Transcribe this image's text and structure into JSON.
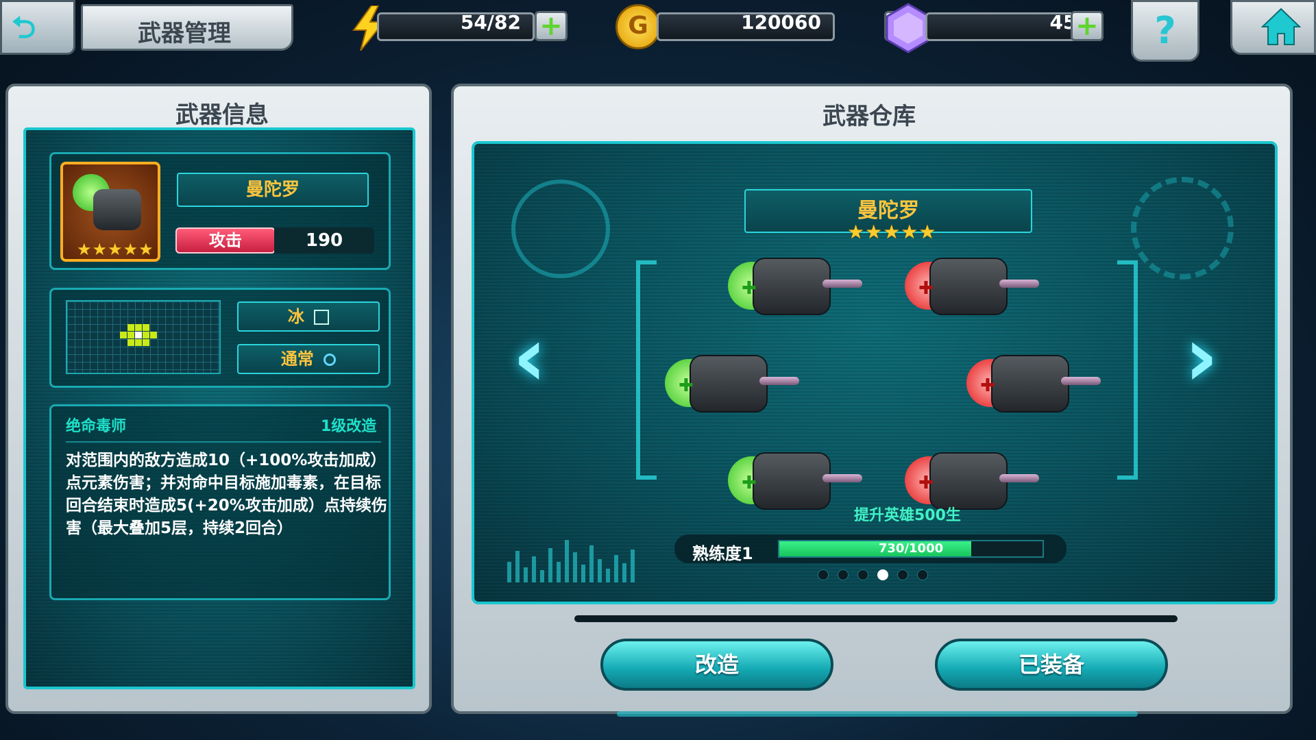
{
  "header": {
    "title": "武器管理",
    "energy": "54/82",
    "gold": "120060",
    "gems": "450",
    "gold_symbol": "G",
    "help_symbol": "?"
  },
  "info_panel": {
    "title": "武器信息",
    "weapon_name": "曼陀罗",
    "stars": "★★★★★",
    "attack_label": "攻击",
    "attack_value": "190",
    "element_label": "冰",
    "type_label": "通常",
    "skill_name": "绝命毒师",
    "upgrade_level": "1级改造",
    "skill_description": "对范围内的敌方造成10（+100%攻击加成）点元素伤害；并对命中目标施加毒素，在目标回合结束时造成5(+20%攻击加成）点持续伤害（最大叠加5层，持续2回合）"
  },
  "warehouse_panel": {
    "title": "武器仓库",
    "weapon_name": "曼陀罗",
    "stars": "★★★★★",
    "overlay_text": "提升英雄500生",
    "proficiency_label": "熟练度1",
    "proficiency_text": "730/1000",
    "proficiency_fraction": 0.73,
    "page_count": 6,
    "active_page": 4,
    "modify_button": "改造",
    "equipped_button": "已装备"
  },
  "colors": {
    "accent": "#1ac7cf",
    "gold_text": "#ffc53d",
    "green_capsule": "#43e03a",
    "red_capsule": "#ff2b2b"
  },
  "icons": [
    "back-icon",
    "lightning-icon",
    "gold-coin-icon",
    "gem-icon",
    "plus-icon",
    "help-icon",
    "home-icon",
    "left-arrow-icon",
    "right-arrow-icon"
  ]
}
